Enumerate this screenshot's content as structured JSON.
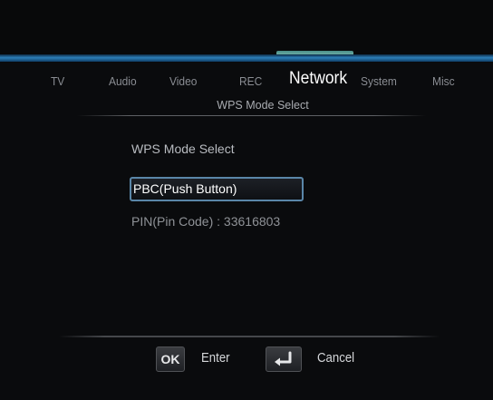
{
  "tabs": [
    {
      "label": "TV"
    },
    {
      "label": "Audio"
    },
    {
      "label": "Video"
    },
    {
      "label": "REC"
    },
    {
      "label": "Network",
      "active": true
    },
    {
      "label": "System"
    },
    {
      "label": "Misc"
    }
  ],
  "page": {
    "subtitle": "WPS Mode Select",
    "section_label": "WPS Mode Select"
  },
  "options": {
    "pbc": "PBC(Push Button)",
    "pin": "PIN(Pin Code) : 33616803"
  },
  "footer": {
    "ok_key": "OK",
    "enter_label": "Enter",
    "back_key_icon": "return-arrow-icon",
    "cancel_label": "Cancel"
  },
  "colors": {
    "accent_blue": "#2d7fb8",
    "highlight_teal": "#6fb0a8",
    "selection_border": "#5a86a8"
  }
}
